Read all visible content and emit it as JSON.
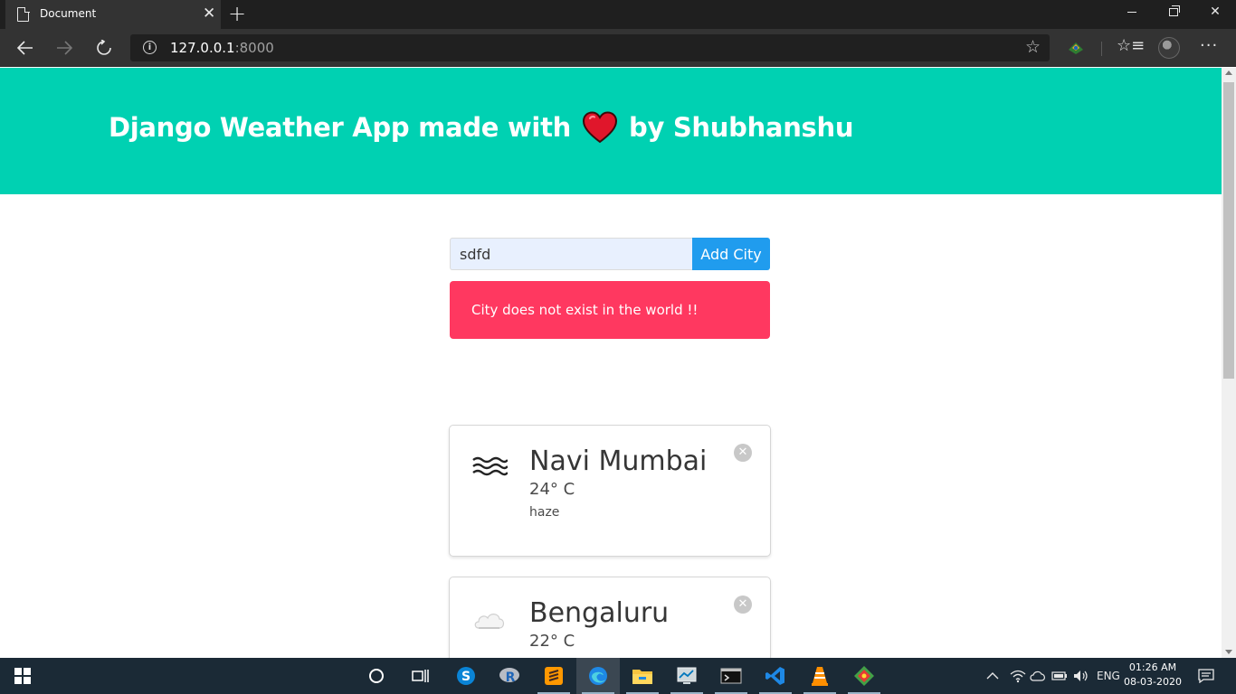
{
  "browser": {
    "tab_title": "Document",
    "url_host": "127.0.0.1",
    "url_port": ":8000"
  },
  "hero": {
    "title_before": "Django Weather App made with",
    "title_after": "by Shubhanshu"
  },
  "form": {
    "input_value": "sdfd",
    "button_label": "Add City"
  },
  "notification": {
    "message": "City does not exist in the world !!",
    "color": "#ff3860"
  },
  "cities": [
    {
      "name": "Navi Mumbai",
      "temperature": "24° C",
      "description": "haze",
      "icon": "haze-icon"
    },
    {
      "name": "Bengaluru",
      "temperature": "22° C",
      "icon": "cloud-icon"
    }
  ],
  "colors": {
    "hero": "#00d1b2",
    "button": "#209cee"
  },
  "taskbar": {
    "language": "ENG",
    "time": "01:26 AM",
    "date": "08-03-2020"
  }
}
